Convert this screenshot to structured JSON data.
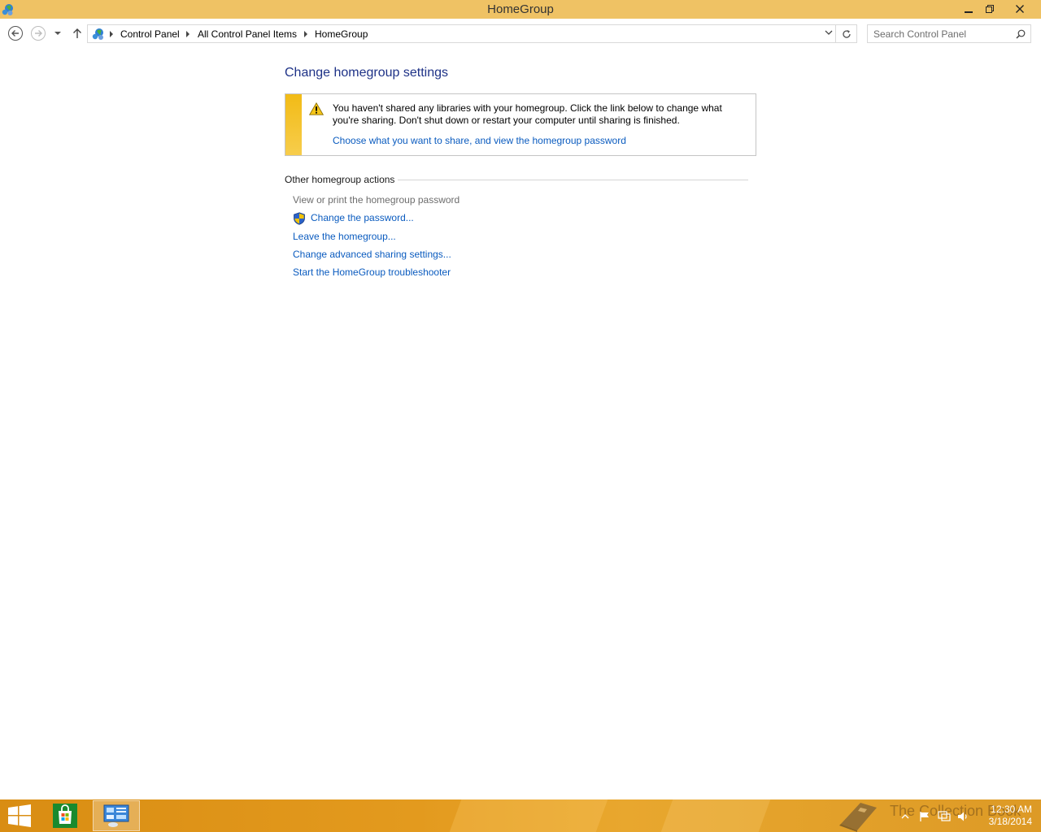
{
  "window": {
    "title": "HomeGroup",
    "buttons": {
      "minimize": "minimize-icon",
      "maximize": "restore-icon",
      "close": "close-icon"
    }
  },
  "address": {
    "breadcrumbs": [
      "Control Panel",
      "All Control Panel Items",
      "HomeGroup"
    ],
    "search_placeholder": "Search Control Panel"
  },
  "main": {
    "title": "Change homegroup settings",
    "info": {
      "message": "You haven't shared any libraries with your homegroup. Click the link below to change what you're sharing. Don't shut down or restart your computer until sharing is finished.",
      "link": "Choose what you want to share, and view the homegroup password"
    },
    "other_actions": {
      "heading": "Other homegroup actions",
      "view_password": "View or print the homegroup password",
      "change_password": "Change the password...",
      "leave": "Leave the homegroup...",
      "advanced": "Change advanced sharing settings...",
      "troubleshooter": "Start the HomeGroup troubleshooter"
    }
  },
  "taskbar": {
    "watermark": "The Collection Book",
    "time": "12:30 AM",
    "date": "3/18/2014"
  },
  "colors": {
    "titlebar": "#efc264",
    "heading_blue": "#1e3287",
    "link_blue": "#0a5bbf",
    "warning_stripe": "#f2bb16",
    "taskbar": "#e39a1e"
  }
}
